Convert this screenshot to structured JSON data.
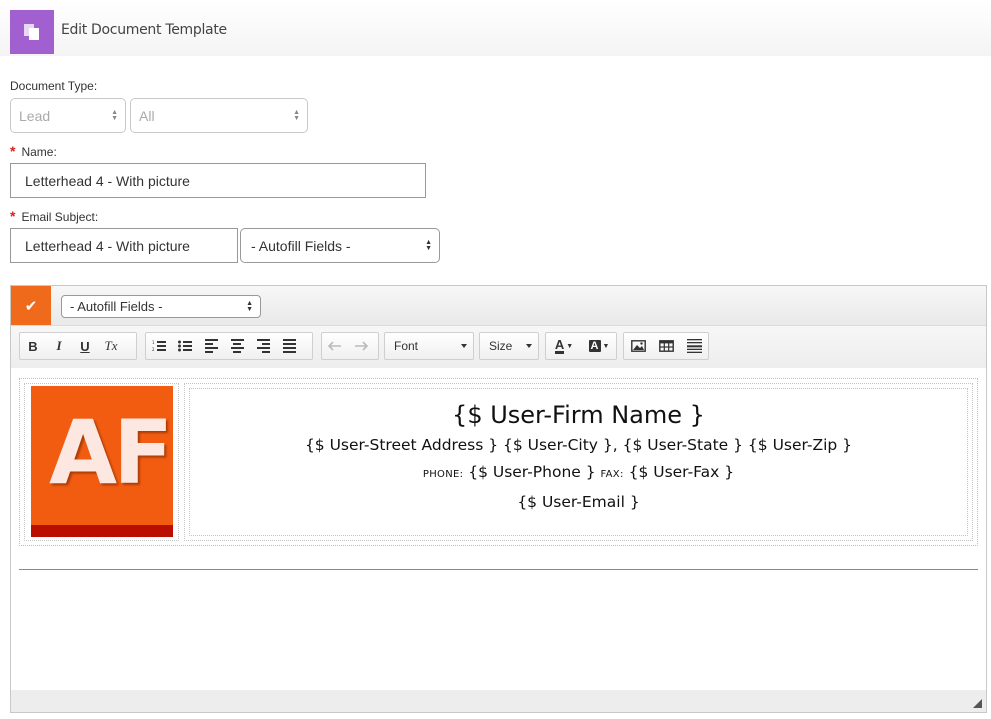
{
  "header": {
    "title": "Edit Document Template",
    "icon": "documents-icon",
    "accent": "#a25fd0"
  },
  "form": {
    "document_type": {
      "label": "Document Type:",
      "value": "Lead",
      "sub_value": "All"
    },
    "name": {
      "label": "Name:",
      "value": "Letterhead 4 - With picture",
      "required_marker": "*"
    },
    "email_subject": {
      "label": "Email Subject:",
      "value": "Letterhead 4 - With picture",
      "autofill": "- Autofill Fields -",
      "required_marker": "*"
    }
  },
  "editor": {
    "autofill": "- Autofill Fields -",
    "check_icon": "check-icon",
    "toolbar": {
      "bold": "B",
      "italic": "I",
      "underline": "U",
      "clear_format": "Tx",
      "font": "Font",
      "size": "Size",
      "text_color": "A",
      "bg_color": "A"
    },
    "letterhead": {
      "logo_text": "AF",
      "firm_name": "{$ User-Firm Name }",
      "address": "{$ User-Street Address } {$ User-City }, {$ User-State } {$ User-Zip }",
      "phone_label": "PHONE:",
      "phone": "{$ User-Phone }",
      "fax_label": "FAX:",
      "fax": "{$ User-Fax }",
      "email": "{$ User-Email }"
    }
  },
  "colors": {
    "orange": "#ef6a1a",
    "logo_orange": "#f25c11",
    "logo_band": "#b90e00",
    "required": "#d81f1f"
  }
}
